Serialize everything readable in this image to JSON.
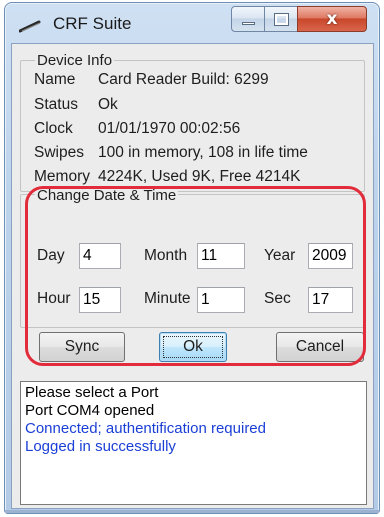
{
  "window": {
    "title": "CRF Suite",
    "close_glyph": "x",
    "accent": "#e22b3b"
  },
  "device_info": {
    "legend": "Device Info",
    "rows": [
      {
        "label": "Name",
        "value": "Card Reader Build: 6299"
      },
      {
        "label": "Status",
        "value": "Ok"
      },
      {
        "label": "Clock",
        "value": "01/01/1970 00:02:56"
      },
      {
        "label": "Swipes",
        "value": "100 in memory, 108 in life time"
      },
      {
        "label": "Memory",
        "value": "4224K, Used 9K, Free 4214K"
      }
    ]
  },
  "date_time": {
    "legend": "Change Date & Time",
    "day_label": "Day",
    "day_value": "4",
    "month_label": "Month",
    "month_value": "11",
    "year_label": "Year",
    "year_value": "2009",
    "hour_label": "Hour",
    "hour_value": "15",
    "minute_label": "Minute",
    "minute_value": "1",
    "sec_label": "Sec",
    "sec_value": "17",
    "sync_label": "Sync",
    "ok_label": "Ok",
    "cancel_label": "Cancel"
  },
  "log": {
    "lines": [
      {
        "text": "Please select a Port",
        "color": "#000000"
      },
      {
        "text": "Port COM4 opened",
        "color": "#000000"
      },
      {
        "text": "Connected; authentification required",
        "color": "#1a3fd6"
      },
      {
        "text": "Logged in successfully",
        "color": "#1a3fd6"
      }
    ]
  }
}
